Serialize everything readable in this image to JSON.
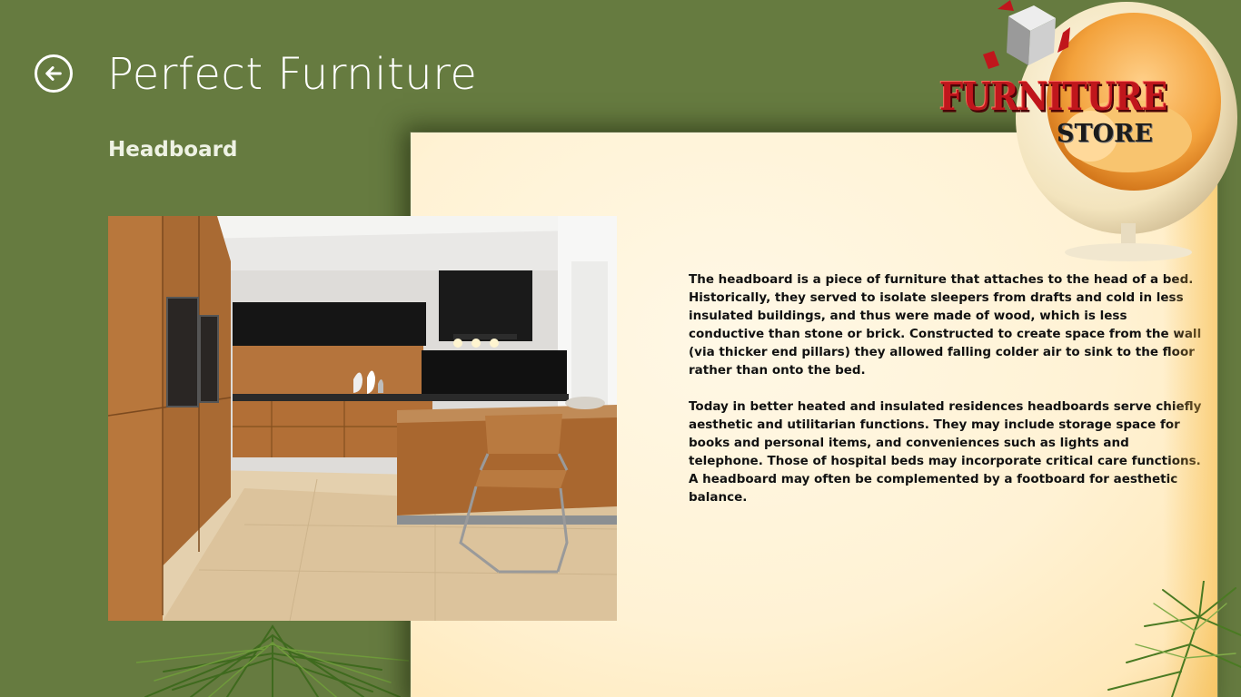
{
  "header": {
    "title": "Perfect Furniture",
    "back_icon": "back-arrow-icon"
  },
  "item": {
    "title": "Headboard",
    "description_paragraphs": [
      "The headboard is a piece of furniture that attaches to the head of a bed. Historically, they served to isolate sleepers from drafts and cold in less insulated buildings, and thus were made of wood, which is less conductive than stone or brick. Constructed to create space from the wall (via thicker end pillars) they allowed falling colder air to sink to the floor rather than onto the bed.",
      "Today in better heated and insulated residences headboards serve chiefly aesthetic and utilitarian functions. They may include storage space for books and personal items, and conveniences such as lights and telephone. Those of hospital beds may incorporate critical care functions. A headboard may often be complemented by a footboard for aesthetic balance."
    ]
  },
  "logo": {
    "word1": "FURNITURE",
    "word2": "STORE"
  },
  "colors": {
    "background": "#667b40",
    "panel": "#fff2d4",
    "logo_red": "#c0161c",
    "text": "#111111"
  }
}
